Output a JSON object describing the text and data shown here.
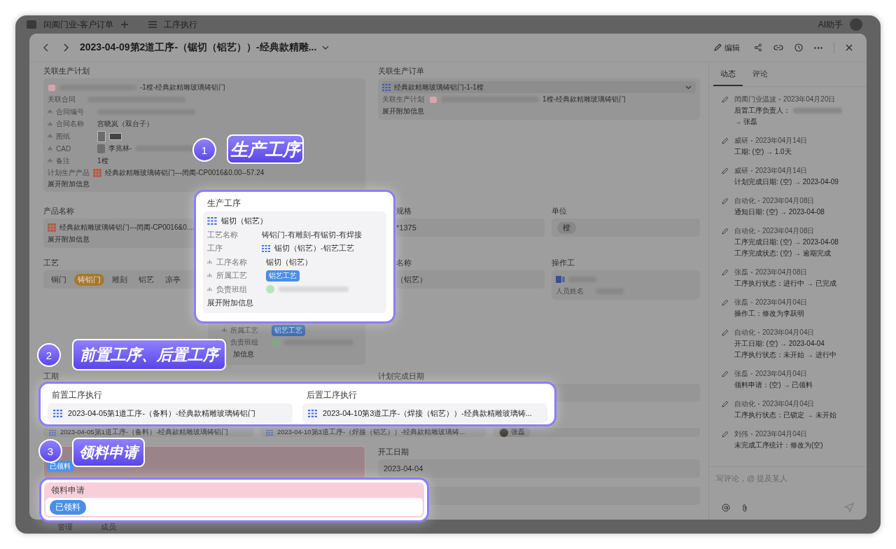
{
  "app_bar": {
    "title": "闰阖门业-客户订单",
    "view": "工序执行",
    "assistant": "AI助手"
  },
  "bottom_bar": [
    "管理",
    "成员"
  ],
  "record": {
    "title": "2023-04-09第2道工序-（锯切（铝艺））-经典款精雕...",
    "edit": "编辑"
  },
  "form": {
    "plan": {
      "label": "关联生产计划",
      "head": "-1樘-经典款精雕玻璃铸铝门",
      "expand": "展开附加信息",
      "fields": [
        {
          "kind": "redacted",
          "label": "关联合同",
          "sub": false
        },
        {
          "kind": "redacted",
          "label": "合同编号",
          "sub": true
        },
        {
          "kind": "text",
          "label": "合同名称",
          "sub": true,
          "value": "宫晓岚（双台子）"
        },
        {
          "kind": "images",
          "label": "图纸",
          "sub": true
        },
        {
          "kind": "file",
          "label": "CAD",
          "sub": true,
          "value": "李兆林-"
        },
        {
          "kind": "text",
          "label": "备注",
          "sub": true,
          "value": "1樘"
        },
        {
          "kind": "product",
          "label": "计划生产产品",
          "sub": false,
          "value": "经典款精雕玻璃铸铝门---闰阖-CP0016&0.00--57.24"
        }
      ]
    },
    "order": {
      "label": "关联生产订单",
      "head": "经典款精雕玻璃铸铝门-1-1樘",
      "sub_label": "关联生产计划",
      "sub_value": "1樘-经典款精雕玻璃铸铝门",
      "expand": "展开附加信息"
    },
    "product": {
      "label": "产品名称",
      "value": "经典款精雕玻璃铸铝门---闰阖-CP0016&0....",
      "expand": "展开附加信息"
    },
    "spec": {
      "label": "规格",
      "value": "*1375"
    },
    "unit": {
      "label": "单位",
      "tag": "樘"
    },
    "craft": {
      "label": "工艺",
      "options": [
        {
          "label": "铜门",
          "selected": false
        },
        {
          "label": "铸铝门",
          "selected": true
        },
        {
          "label": "雕刻",
          "selected": false
        },
        {
          "label": "铝艺",
          "selected": false
        },
        {
          "label": "凉亭",
          "selected": false
        }
      ]
    },
    "process_under": {
      "fields": [
        {
          "label": "所属工艺",
          "kind": "tag",
          "value": "铝艺工艺"
        },
        {
          "label": "负责班组",
          "kind": "member"
        }
      ],
      "expand": "加信息"
    },
    "process_name": {
      "label": "名称",
      "value": "（铝艺）"
    },
    "operator": {
      "label": "操作工",
      "sub_label": "人员姓名"
    },
    "duration": {
      "label": "工期"
    },
    "plan_finish": {
      "label": "计划完成日期"
    },
    "links": {
      "previous": "2023-04-05第1道工序-（备料）-经典款精雕玻璃铸铝门",
      "next": "2023-04-10第3道工序-（焊接（铝艺））-经典款精雕玻璃铸...",
      "owner": "张磊"
    },
    "material": {
      "tag": "已领料"
    },
    "start": {
      "label": "开工日期",
      "value": "2023-04-04"
    }
  },
  "activity": {
    "tabs": [
      {
        "label": "动态",
        "selected": true
      },
      {
        "label": "评论",
        "selected": false
      }
    ],
    "entries": [
      {
        "author": "闰阖门业温波",
        "date": "2023年04月20日",
        "redacted": true,
        "lines": [
          "后置工序负责人：",
          "→ 张磊"
        ]
      },
      {
        "author": "威研",
        "date": "2023年04月14日",
        "redacted": false,
        "lines": [
          "工期: (空) → 1.0天"
        ]
      },
      {
        "author": "威研",
        "date": "2023年04月14日",
        "redacted": false,
        "lines": [
          "计划完成日期: (空) → 2023-04-09"
        ]
      },
      {
        "author": "自动化",
        "date": "2023年04月08日",
        "redacted": false,
        "lines": [
          "通知日期: (空) → 2023-04-08"
        ]
      },
      {
        "author": "自动化",
        "date": "2023年04月08日",
        "redacted": false,
        "lines": [
          "工序完成日期: (空) → 2023-04-08",
          "工序完成状态: (空) → 逾期完成"
        ]
      },
      {
        "author": "张磊",
        "date": "2023年04月08日",
        "redacted": false,
        "lines": [
          "工序执行状态：进行中 → 已完成"
        ]
      },
      {
        "author": "张磊",
        "date": "2023年04月04日",
        "redacted": false,
        "lines": [
          "操作工：修改为李跃明"
        ]
      },
      {
        "author": "自动化",
        "date": "2023年04月04日",
        "redacted": false,
        "lines": [
          "开工日期: (空) → 2023-04-04",
          "工序执行状态：未开始 → 进行中"
        ]
      },
      {
        "author": "张磊",
        "date": "2023年04月04日",
        "redacted": false,
        "lines": [
          "领料申请：(空) → 已领料"
        ]
      },
      {
        "author": "自动化",
        "date": "2023年04月04日",
        "redacted": false,
        "lines": [
          "工序执行状态：已锁定 → 未开始"
        ]
      },
      {
        "author": "刘伟",
        "date": "2023年04月04日",
        "redacted": false,
        "lines": [
          "未完成工序统计：修改为(空)"
        ]
      }
    ],
    "comment_placeholder": "写评论，@ 提及某人"
  },
  "callouts": [
    {
      "number": "1",
      "label": "生产工序"
    },
    {
      "number": "2",
      "label": "前置工序、后置工序"
    },
    {
      "number": "3",
      "label": "领料申请"
    }
  ],
  "popup_process": {
    "title": "生产工序",
    "head": "锯切（铝艺）",
    "expand": "展开附加信息",
    "fields": [
      {
        "kind": "text",
        "label": "工艺名称",
        "sub": false,
        "value": "铸铝门-有雕刻-有锯切-有焊接"
      },
      {
        "kind": "record",
        "label": "工序",
        "sub": false,
        "value": "锯切（铝艺）-铝艺工艺"
      },
      {
        "kind": "text",
        "label": "工序名称",
        "sub": true,
        "value": "锯切（铝艺）"
      },
      {
        "kind": "tag",
        "label": "所属工艺",
        "sub": true,
        "value": "铝艺工艺"
      },
      {
        "kind": "member",
        "label": "负责班组",
        "sub": true
      }
    ]
  },
  "popup_links": [
    {
      "label": "前置工序执行",
      "item": "2023-04-05第1道工序-（备料）-经典款精雕玻璃铸铝门"
    },
    {
      "label": "后置工序执行",
      "item": "2023-04-10第3道工序-（焊接（铝艺））-经典款精雕玻璃铸..."
    }
  ],
  "popup_material": {
    "label": "领料申请",
    "tag": "已领料"
  }
}
